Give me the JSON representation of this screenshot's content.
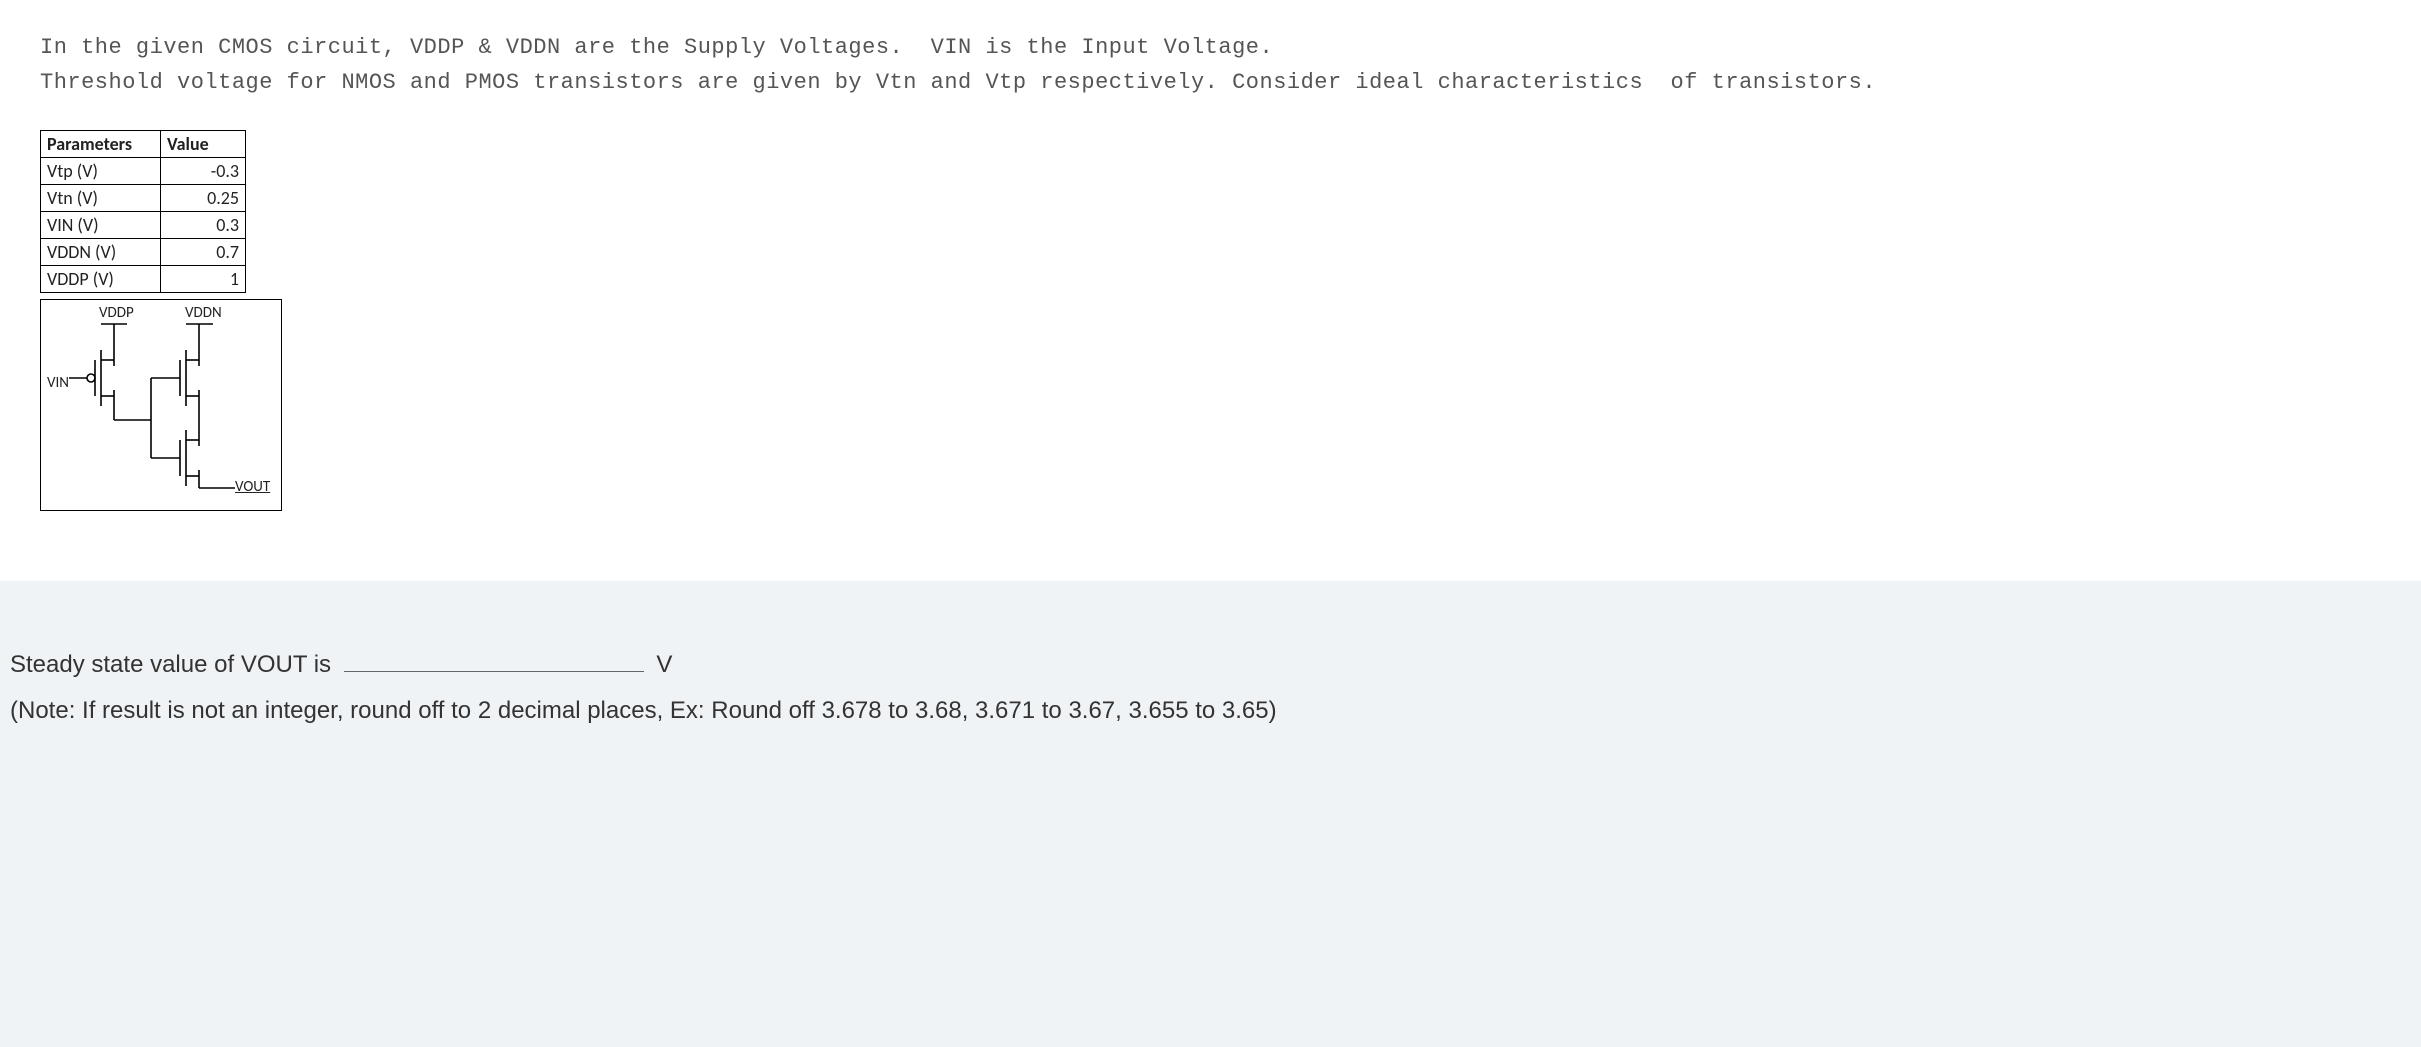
{
  "question": {
    "line1": "In the given CMOS circuit, VDDP & VDDN are the Supply Voltages.  VIN is the Input Voltage.",
    "line2": "Threshold voltage for NMOS and PMOS transistors are given by Vtn and Vtp respectively. Consider ideal characteristics  of transistors."
  },
  "param_table": {
    "headers": {
      "param": "Parameters",
      "value": "Value"
    },
    "rows": [
      {
        "param": "Vtp (V)",
        "value": "-0.3"
      },
      {
        "param": "Vtn (V)",
        "value": "0.25"
      },
      {
        "param": "VIN (V)",
        "value": "0.3"
      },
      {
        "param": "VDDN (V)",
        "value": "0.7"
      },
      {
        "param": "VDDP (V)",
        "value": "1"
      }
    ]
  },
  "circuit_labels": {
    "vddp": "VDDP",
    "vddn": "VDDN",
    "vin": "VIN",
    "vout": "VOUT"
  },
  "answer": {
    "prompt_prefix": "Steady state value of VOUT is",
    "prompt_suffix": "V",
    "note": "(Note: If result is not an integer, round off to 2 decimal places, Ex: Round off 3.678 to 3.68, 3.671 to 3.67, 3.655 to 3.65)"
  }
}
